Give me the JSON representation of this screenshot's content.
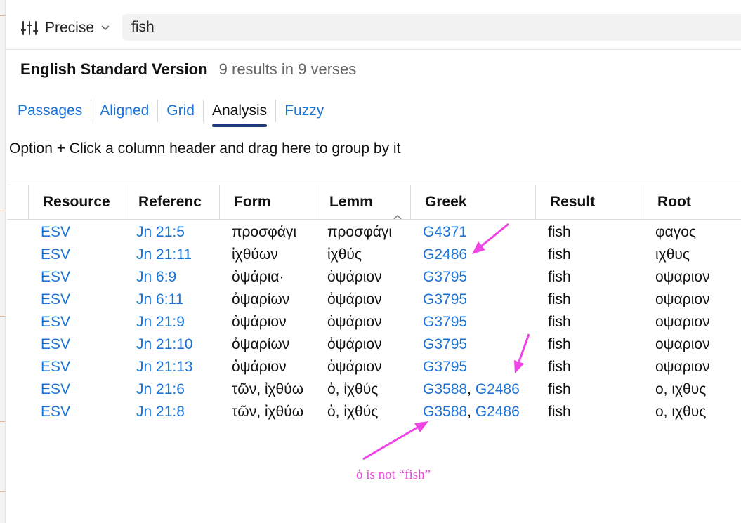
{
  "toolbar": {
    "mode_icon": "sliders-icon",
    "mode_label": "Precise",
    "mode_chevron_icon": "chevron-down-icon",
    "search_value": "fish"
  },
  "results": {
    "version": "English Standard Version",
    "count": "9 results in 9 verses"
  },
  "tabs": [
    "Passages",
    "Aligned",
    "Grid",
    "Analysis",
    "Fuzzy"
  ],
  "active_tab": "Analysis",
  "group_hint": "Option + Click a column header and drag here to group by it",
  "table": {
    "columns": [
      "Resource",
      "Referenc",
      "Form",
      "Lemm",
      "Greek",
      "Result",
      "Root"
    ],
    "sort_icon": "sort-ascending-icon",
    "rows": [
      {
        "resource": "ESV",
        "reference": "Jn 21:5",
        "form": "προσφάγι",
        "lemma": "προσφάγι",
        "greek": [
          "G4371"
        ],
        "result": "fish",
        "root": "φαγος"
      },
      {
        "resource": "ESV",
        "reference": "Jn 21:11",
        "form": "ἰχθύων",
        "lemma": "ἰχθύς",
        "greek": [
          "G2486"
        ],
        "result": "fish",
        "root": "ιχθυς"
      },
      {
        "resource": "ESV",
        "reference": "Jn 6:9",
        "form": "ὀψάρια·",
        "lemma": "ὀψάριον",
        "greek": [
          "G3795"
        ],
        "result": "fish",
        "root": "οψαριον"
      },
      {
        "resource": "ESV",
        "reference": "Jn 6:11",
        "form": "ὀψαρίων",
        "lemma": "ὀψάριον",
        "greek": [
          "G3795"
        ],
        "result": "fish",
        "root": "οψαριον"
      },
      {
        "resource": "ESV",
        "reference": "Jn 21:9",
        "form": "ὀψάριον",
        "lemma": "ὀψάριον",
        "greek": [
          "G3795"
        ],
        "result": "fish",
        "root": "οψαριον"
      },
      {
        "resource": "ESV",
        "reference": "Jn 21:10",
        "form": "ὀψαρίων",
        "lemma": "ὀψάριον",
        "greek": [
          "G3795"
        ],
        "result": "fish",
        "root": "οψαριον"
      },
      {
        "resource": "ESV",
        "reference": "Jn 21:13",
        "form": "ὀψάριον",
        "lemma": "ὀψάριον",
        "greek": [
          "G3795"
        ],
        "result": "fish",
        "root": "οψαριον"
      },
      {
        "resource": "ESV",
        "reference": "Jn 21:6",
        "form": "τῶν, ἰχθύω",
        "lemma": "ὁ, ἰχθύς",
        "greek": [
          "G3588",
          "G2486"
        ],
        "result": "fish",
        "root": "ο, ιχθυς"
      },
      {
        "resource": "ESV",
        "reference": "Jn 21:8",
        "form": "τῶν, ἰχθύω",
        "lemma": "ὁ, ἰχθύς",
        "greek": [
          "G3588",
          "G2486"
        ],
        "result": "fish",
        "root": "ο, ιχθυς"
      }
    ]
  },
  "annotation": {
    "text": "ὁ is not “fish”",
    "color": "#ee44e6"
  },
  "colors": {
    "link": "#1a73d9",
    "active_tab_underline": "#1b3a7a"
  }
}
